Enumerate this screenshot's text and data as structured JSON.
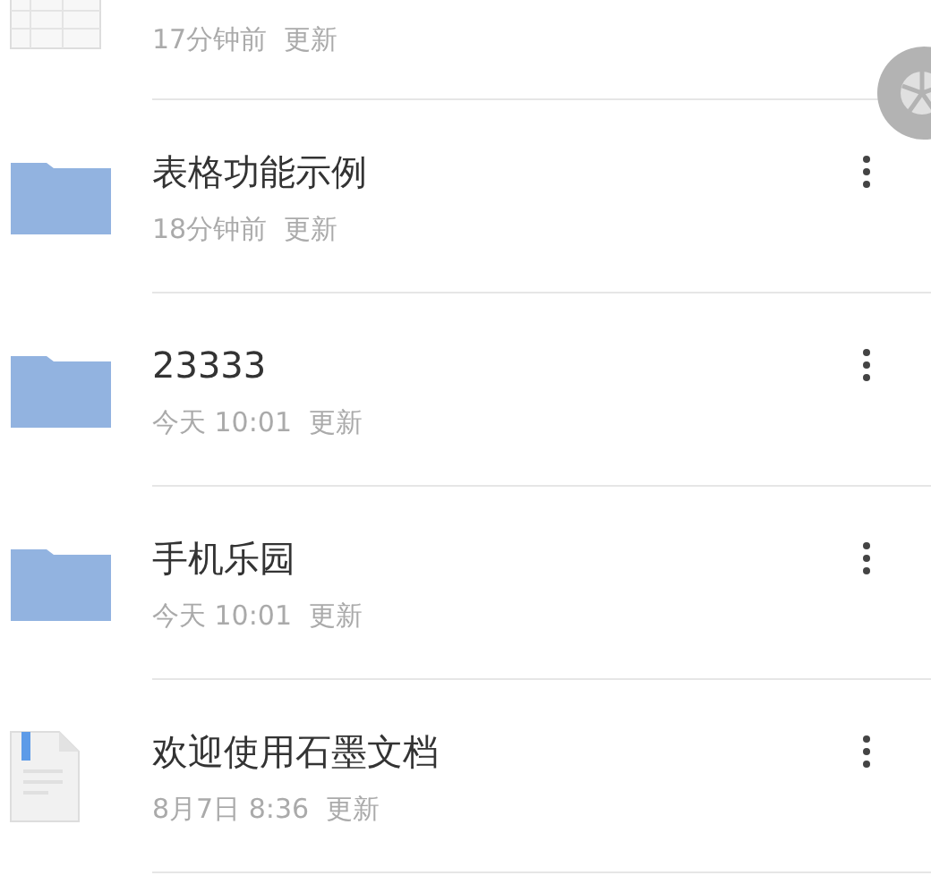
{
  "files": [
    {
      "kind": "spreadsheet",
      "meta": "17分钟前  更新"
    },
    {
      "kind": "folder",
      "name": "表格功能示例",
      "meta": "18分钟前  更新"
    },
    {
      "kind": "folder",
      "name": "23333",
      "meta": "今天 10:01  更新"
    },
    {
      "kind": "folder",
      "name": "手机乐园",
      "meta": "今天 10:01  更新"
    },
    {
      "kind": "document",
      "name": "欢迎使用石墨文档",
      "meta": "8月7日 8:36  更新"
    }
  ]
}
